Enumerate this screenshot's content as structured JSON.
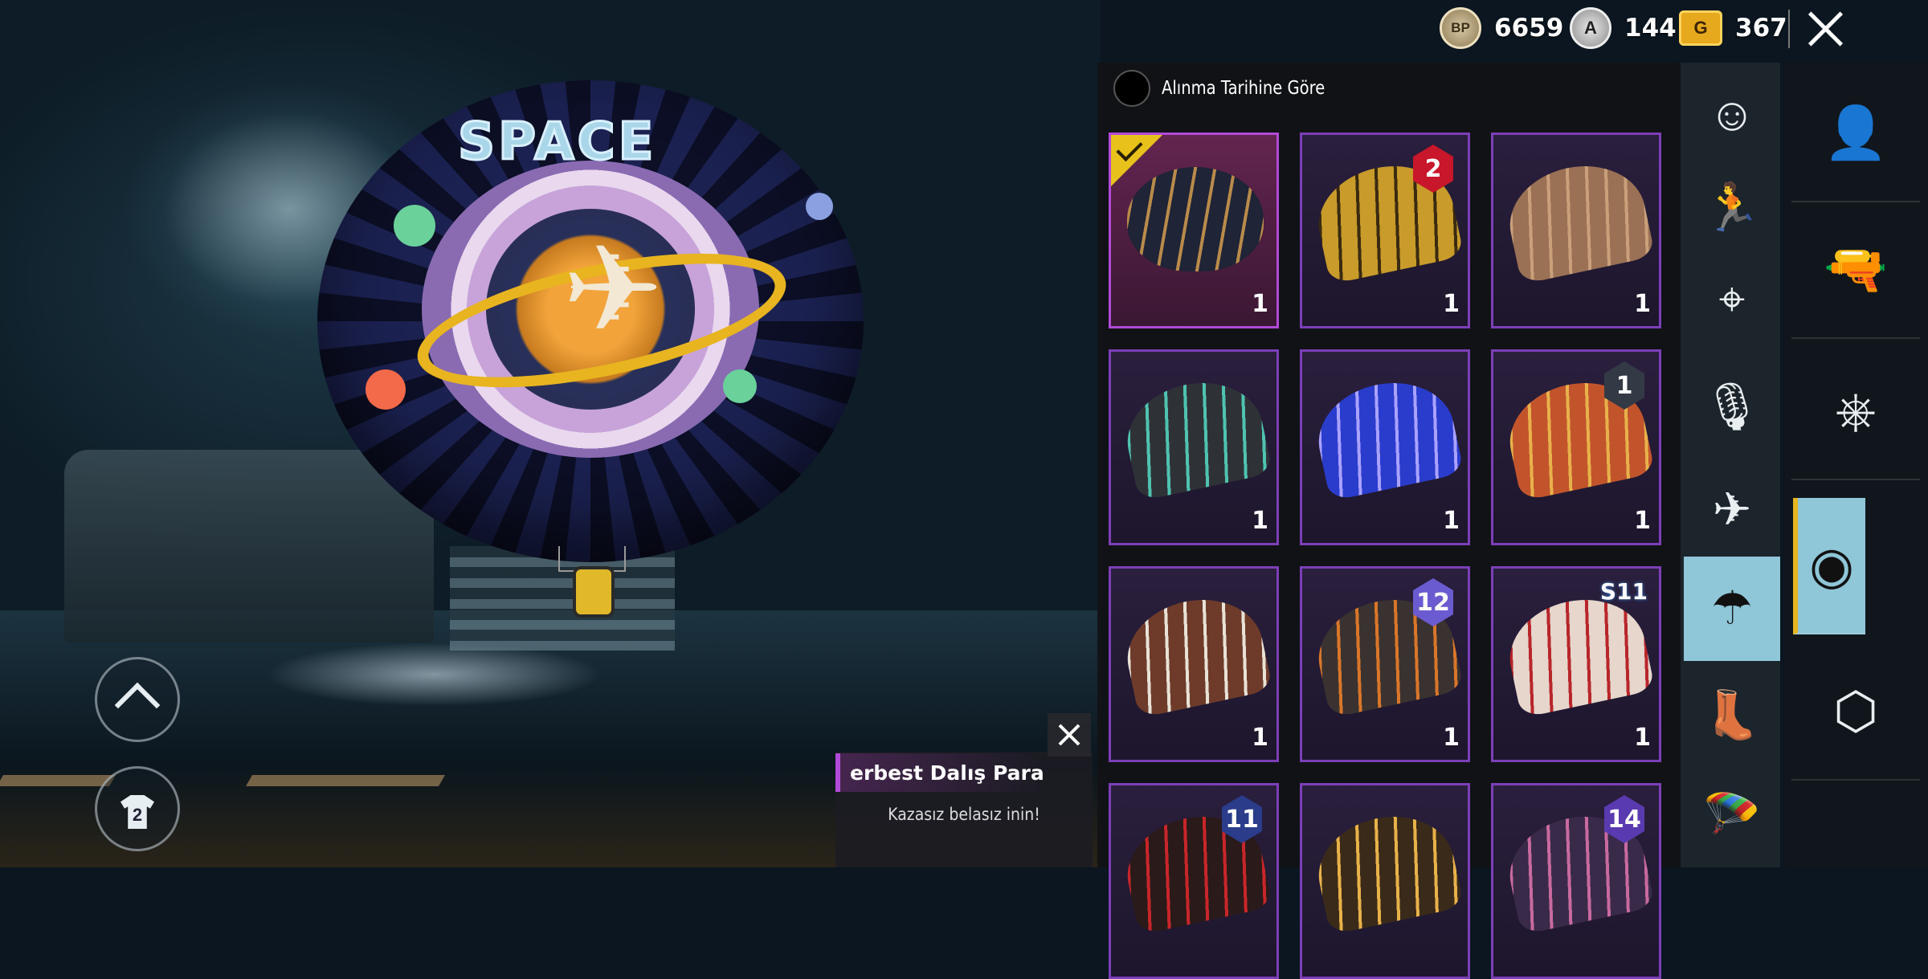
{
  "preview": {
    "parachute_print": "SPACE",
    "colors": {
      "canopy_dark": "#0c0f25",
      "canopy_blue": "#1b2150",
      "ring": "#c7a3d9",
      "orbit": "#e8b420"
    }
  },
  "currency": {
    "bp": {
      "icon": "bp-coin-icon",
      "label": "BP",
      "value": "6659"
    },
    "ag": {
      "icon": "ag-coin-icon",
      "label": "A",
      "value": "144"
    },
    "uc": {
      "icon": "uc-coin-icon",
      "label": "G",
      "value": "367"
    }
  },
  "sort": {
    "label": "Alınma Tarihine Göre"
  },
  "left_buttons": {
    "up": {
      "icon": "chevron-up-icon"
    },
    "wardrobe": {
      "icon": "wardrobe-hanger-icon",
      "number": "2"
    }
  },
  "items": [
    {
      "count": "1",
      "selected": true,
      "art_color": "#1f2436",
      "art_accent": "#b98a4a",
      "badge": ""
    },
    {
      "count": "1",
      "selected": false,
      "art_color": "#c89b2a",
      "art_accent": "#3a2a10",
      "badge": "2",
      "badge_color": "#c8162a"
    },
    {
      "count": "1",
      "selected": false,
      "art_color": "#9a7155",
      "art_accent": "#c9a07a",
      "badge": ""
    },
    {
      "count": "1",
      "selected": false,
      "art_color": "#2e3237",
      "art_accent": "#4fc3b0",
      "badge": ""
    },
    {
      "count": "1",
      "selected": false,
      "art_color": "#2a3ccc",
      "art_accent": "#a9a1ff",
      "badge": ""
    },
    {
      "count": "1",
      "selected": false,
      "art_color": "#c2542c",
      "art_accent": "#e8b24a",
      "badge": "1",
      "badge_color": "#333a45"
    },
    {
      "count": "1",
      "selected": false,
      "art_color": "#6e3b2a",
      "art_accent": "#e8e2d6",
      "badge": ""
    },
    {
      "count": "1",
      "selected": false,
      "art_color": "#3a3230",
      "art_accent": "#d9762a",
      "badge": "12",
      "badge_color": "#6a5bd0"
    },
    {
      "count": "1",
      "selected": false,
      "art_color": "#e6d6cc",
      "art_accent": "#b8262a",
      "badge": "S11",
      "badge_color": "#3a7bd0"
    },
    {
      "count": "",
      "selected": false,
      "art_color": "#2a1a1a",
      "art_accent": "#c8262a",
      "badge": "11",
      "badge_color": "#2a3c8a"
    },
    {
      "count": "",
      "selected": false,
      "art_color": "#3a2a1a",
      "art_accent": "#e8b24a",
      "badge": ""
    },
    {
      "count": "",
      "selected": false,
      "art_color": "#3a2a4a",
      "art_accent": "#c86aa0",
      "badge": "14",
      "badge_color": "#5a3ab0"
    }
  ],
  "categories": [
    {
      "name": "emote-face-icon",
      "glyph": "☺"
    },
    {
      "name": "emote-action-icon",
      "glyph": "🏃"
    },
    {
      "name": "location-pin-icon",
      "glyph": "⌖"
    },
    {
      "name": "microphone-icon",
      "glyph": "🎙"
    },
    {
      "name": "airplane-icon",
      "glyph": "✈"
    },
    {
      "name": "parachute-icon",
      "glyph": "☂",
      "active": true
    },
    {
      "name": "boots-icon",
      "glyph": "👢"
    },
    {
      "name": "skydive-icon",
      "glyph": "🪂"
    }
  ],
  "main_tabs": [
    {
      "name": "character-icon",
      "glyph": "👤"
    },
    {
      "name": "pistol-icon",
      "glyph": "🔫"
    },
    {
      "name": "steering-wheel-icon",
      "glyph": "⎈"
    },
    {
      "name": "avatar-outfit-icon",
      "glyph": "◉",
      "active": true
    },
    {
      "name": "crate-box-icon",
      "glyph": "⬡"
    }
  ],
  "popup": {
    "title": "erbest Dalış Paraşütü",
    "description": "Kazasız belasız inin!"
  }
}
